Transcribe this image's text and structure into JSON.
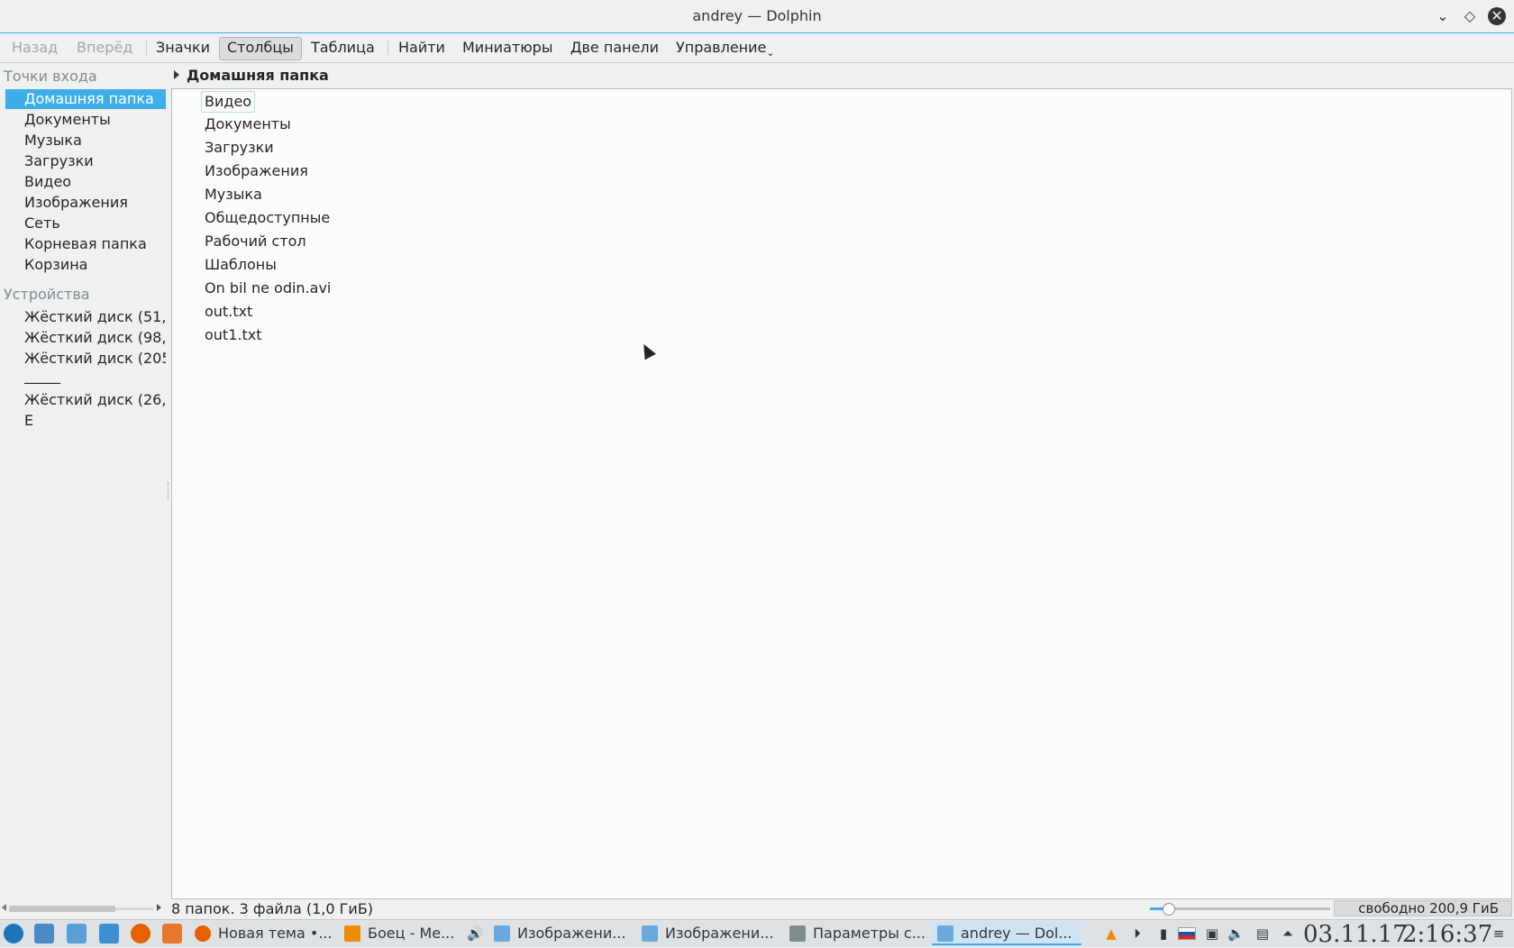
{
  "window": {
    "title": "andrey — Dolphin",
    "buttons": [
      "minimize",
      "maximize",
      "close"
    ]
  },
  "toolbar": {
    "back": "Назад",
    "forward": "Вперёд",
    "icons": "Значки",
    "columns": "Столбцы",
    "details": "Таблица",
    "find": "Найти",
    "previews": "Миниатюры",
    "split": "Две панели",
    "control": "Управление"
  },
  "places": {
    "entry_points_header": "Точки входа",
    "entry_points": [
      "Домашняя папка",
      "Документы",
      "Музыка",
      "Загрузки",
      "Видео",
      "Изображения",
      "Сеть",
      "Корневая папка",
      "Корзина"
    ],
    "selected": "Домашняя папка",
    "devices_header": "Устройства",
    "devices": [
      "Жёсткий диск (51,",
      "Жёсткий диск (98,",
      "Жёсткий диск (205",
      "_____",
      "Жёсткий диск (26,",
      "E"
    ]
  },
  "location": {
    "crumb": "Домашняя папка"
  },
  "files": [
    "Видео",
    "Документы",
    "Загрузки",
    "Изображения",
    "Музыка",
    "Общедоступные",
    "Рабочий стол",
    "Шаблоны",
    "On bil ne odin.avi",
    "out.txt",
    "out1.txt"
  ],
  "status": {
    "summary": "8 папок. 3 файла (1,0 ГиБ)",
    "free_space": "свободно 200,9 ГиБ",
    "zoom_fraction": 0.1
  },
  "taskbar": {
    "tasks": [
      {
        "label": "Новая тема •...",
        "icon": "firefox-icon"
      },
      {
        "label": "Боец - Ме...",
        "icon": "vlc-icon"
      },
      {
        "label": "Изображени...",
        "icon": "folder-icon"
      },
      {
        "label": "Изображени...",
        "icon": "folder-icon"
      },
      {
        "label": "Параметры с...",
        "icon": "settings-icon"
      },
      {
        "label": "andrey — Dol...",
        "icon": "folder-icon"
      }
    ],
    "date": "03.11.17",
    "time": "2:16:37"
  },
  "colors": {
    "accent": "#3daee9",
    "window_bg": "#eff0f1",
    "view_bg": "#fcfcfc",
    "text": "#232627"
  }
}
